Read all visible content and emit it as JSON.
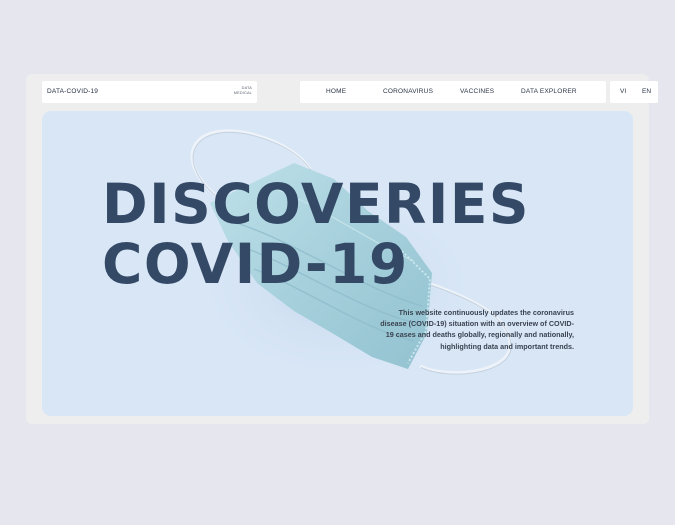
{
  "brand": {
    "name": "DATA-COVID-19",
    "sub_line1": "DATA",
    "sub_line2": "MEDICAL"
  },
  "nav": {
    "items": [
      {
        "label": "HOME"
      },
      {
        "label": "CORONAVIRUS"
      },
      {
        "label": "VACCINES"
      },
      {
        "label": "DATA EXPLORER"
      }
    ]
  },
  "lang": {
    "options": [
      "VI",
      "EN"
    ]
  },
  "hero": {
    "title_line1": "DISCOVERIES",
    "title_line2": "COVID-19",
    "description": "This website continuously updates the coronavirus disease (COVID-19) situation with an overview of COVID-19 cases and deaths globally, regionally and nationally, highlighting data and important trends.",
    "image": "surgical-mask-image"
  },
  "colors": {
    "page_bg": "#e5e6ee",
    "frame_bg": "#eeeeee",
    "hero_bg": "#d8e6f6",
    "title": "#334966",
    "mask": "#a9d3df"
  }
}
